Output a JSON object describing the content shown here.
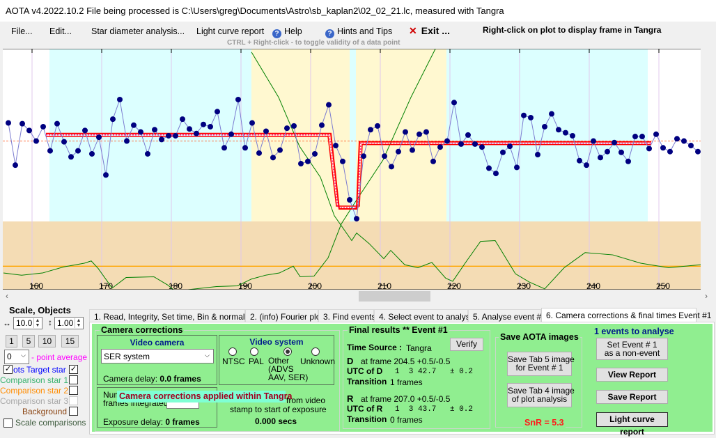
{
  "window": {
    "title": "AOTA v4.2022.10.2    File being processed is C:\\Users\\greg\\Documents\\Astro\\sb_kaplan2\\02_02_21.lc, measured with Tangra"
  },
  "menu": {
    "file": "File...",
    "edit": "Edit...",
    "star_diameter": "Star diameter analysis...",
    "light_curve_report": "Light curve report",
    "help": "Help",
    "hints": "Hints and Tips",
    "exit": "Exit ...",
    "exit_icon": "x-icon",
    "help_icon": "question-circle-icon"
  },
  "hint_text": "CTRL + Right-click  -  to toggle validity of a data point",
  "right_click_text": "Right-click on plot to display frame in Tangra",
  "chart_data": {
    "type": "scatter",
    "xticks": [
      160,
      170,
      180,
      190,
      200,
      210,
      220,
      230,
      240,
      250
    ],
    "x_range": [
      155.4,
      255.4
    ],
    "colors": {
      "points": "#000080",
      "line": "#7b7bd0",
      "model": "#ff0000",
      "curve": "#008000",
      "orange": "#ffa500",
      "cyan_region": "#dcffff",
      "yellow_region": "#fff8d0",
      "lower_panel": "#f4dcb4",
      "grid": "#e0c8ec"
    },
    "regions": [
      {
        "kind": "baseline",
        "from": 161.9,
        "to": 190.9
      },
      {
        "kind": "event",
        "from": 190.9,
        "to": 205.0
      },
      {
        "kind": "baseline",
        "from": 205.0,
        "to": 205.9
      },
      {
        "kind": "event",
        "from": 205.9,
        "to": 218.9
      },
      {
        "kind": "baseline",
        "from": 218.9,
        "to": 247.8
      }
    ],
    "points": {
      "x": [
        156,
        157,
        158,
        159,
        160,
        161,
        162,
        163,
        164,
        165,
        166,
        167,
        168,
        169,
        170,
        171,
        172,
        173,
        174,
        175,
        176,
        177,
        178,
        179,
        180,
        181,
        182,
        183,
        184,
        185,
        186,
        187,
        188,
        189,
        190,
        191,
        192,
        193,
        194,
        195,
        196,
        197,
        198,
        199,
        200,
        201,
        202,
        203,
        204,
        205,
        206,
        207,
        208,
        209,
        210,
        211,
        212,
        213,
        214,
        215,
        216,
        217,
        218,
        219,
        220,
        221,
        222,
        223,
        224,
        225,
        226,
        227,
        228,
        229,
        230,
        231,
        232,
        233,
        234,
        235,
        236,
        237,
        238,
        239,
        240,
        241,
        242,
        243,
        244,
        245,
        246,
        247,
        248,
        249,
        250,
        251,
        252,
        253,
        254,
        255
      ],
      "y": [
        1.14,
        0.58,
        1.13,
        1.04,
        0.9,
        1.09,
        0.77,
        1.13,
        0.89,
        0.69,
        0.77,
        1.04,
        0.73,
        0.95,
        0.45,
        1.19,
        1.45,
        0.9,
        1.11,
        1.02,
        0.73,
        1.05,
        0.92,
        0.97,
        0.97,
        1.19,
        1.06,
        1.0,
        1.12,
        1.09,
        1.29,
        0.81,
        0.99,
        1.45,
        0.81,
        1.14,
        0.74,
        1.03,
        0.68,
        0.78,
        1.07,
        1.1,
        0.6,
        0.63,
        0.73,
        1.11,
        1.38,
        0.84,
        0.63,
        0.12,
        -0.13,
        0.7,
        1.05,
        1.1,
        0.7,
        0.56,
        0.76,
        1.02,
        0.78,
        0.99,
        1.02,
        0.63,
        0.82,
        0.9,
        1.41,
        0.86,
        0.98,
        0.86,
        0.82,
        0.54,
        0.47,
        0.75,
        0.83,
        0.55,
        1.24,
        1.21,
        0.72,
        1.09,
        1.26,
        1.05,
        1.01,
        0.97,
        0.64,
        0.58,
        0.9,
        0.68,
        0.76,
        0.88,
        0.75,
        0.63,
        0.96,
        0.96,
        0.8,
        0.99,
        0.81,
        0.76,
        0.93,
        0.9,
        0.84,
        0.76
      ]
    },
    "model": {
      "baseline_before": 1.0,
      "baseline_after": 0.89,
      "event_level": 0.0,
      "start": 161.4,
      "end": 248.3,
      "d_frame": 204.5,
      "r_frame": 207.0
    },
    "mean_level": 0.9,
    "lower_threshold": -0.76,
    "curves": [
      {
        "x": [
          155.3,
          157.9,
          160.9,
          163.9,
          166.9,
          167.9,
          168.9,
          170.9,
          172.9,
          176.9,
          178.9,
          179.9,
          185.9,
          188.9,
          190.9,
          192.9,
          194.9,
          196.9,
          197.9,
          199.9,
          201.9,
          203.8,
          205.8,
          209.8,
          213.8,
          217.3
        ],
        "y": [
          -0.85,
          -0.88,
          -0.85,
          -0.77,
          -0.72,
          -0.69,
          -0.79,
          -1.05,
          -0.91,
          -0.9,
          -1.01,
          -1.09,
          -1.03,
          -1.02,
          -0.93,
          -0.88,
          -0.85,
          -0.76,
          -0.9,
          -0.89,
          -0.65,
          -0.2,
          0.09,
          0.65,
          1.48,
          2.12
        ]
      },
      {
        "x": [
          190.9,
          194.8,
          197.8,
          200.8,
          202.8,
          205.3,
          206.0,
          207.8,
          209.9,
          210.9,
          212.9,
          214.8,
          216.8,
          218.8,
          219.8,
          221.8,
          223.8,
          225.9,
          228.8,
          230.8,
          233.0,
          235.8,
          238.8,
          242.8,
          246.8,
          250.8,
          255.4
        ],
        "y": [
          2.08,
          1.48,
          0.83,
          0.42,
          -0.09,
          -0.42,
          -0.32,
          -0.46,
          -0.66,
          -0.55,
          -0.74,
          -0.78,
          -0.71,
          -0.92,
          -0.96,
          -0.69,
          -0.43,
          -0.42,
          -0.86,
          -0.97,
          -1.06,
          -0.78,
          -0.58,
          -0.61,
          -0.72,
          -0.78,
          -0.74
        ]
      }
    ]
  },
  "left_panel": {
    "title": "Scale,  Objects",
    "h_scale": "10.0",
    "v_scale": "1.00",
    "h_icon": "horizontal-arrows-icon",
    "v_icon": "vertical-arrows-icon",
    "buttons": [
      "1",
      "5",
      "10",
      "15"
    ],
    "average_value": "0",
    "average_label": "- point average",
    "dots_label": "ots",
    "target_label": "Target star",
    "comp1": "Comparison star 1",
    "comp2": "Comparison star 2",
    "comp3": "Comparison star 3",
    "background": "Background",
    "scale_comparisons": "Scale comparisons",
    "colors": {
      "target": "#0000ff",
      "comp1": "#3cb371",
      "comp2": "#ff8c00",
      "comp3": "#a9a9a9",
      "background": "#8b4513",
      "average": "#ff00ff"
    }
  },
  "tabs": [
    {
      "label": "1.  Read, Integrity, Set time, Bin & normalise"
    },
    {
      "label": "2. (info)  Fourier plot"
    },
    {
      "label": "3. Find events"
    },
    {
      "label": "4. Select event to analyse"
    },
    {
      "label": "5. Analyse event #1"
    },
    {
      "label": "6. Camera corrections & final times Event #1",
      "active": true
    }
  ],
  "camera": {
    "group_title": "Camera corrections",
    "video_camera_title": "Video camera",
    "camera_select": "SER system",
    "camera_delay_label": "Camera delay:",
    "camera_delay_value": "0.0 frames",
    "video_system_title": "Video system",
    "systems": [
      "NTSC",
      "PAL",
      "Other\n(ADVS\nAAV, SER)",
      "Unknown"
    ],
    "selected_system": "Other",
    "frames_label_1": "Num",
    "frames_label_2": "frames integrated",
    "exposure_delay_label": "Exposure delay:",
    "exposure_delay_value": "0 frames",
    "offset_label_1": "from video",
    "offset_label_2": "stamp to start of exposure",
    "offset_value": "0.000 secs",
    "tooltip": "Camera corrections applied within Tangra"
  },
  "final": {
    "title": "Final results  **  Event #1",
    "time_source_label": "Time Source :",
    "time_source": "Tangra",
    "verify": "Verify",
    "d_label": "D",
    "d_frame": "at frame 204.5  +0.5/-0.5",
    "utc_d_label": "UTC of D",
    "utc_d": "1  3 42.7",
    "utc_d_err": "± 0.2",
    "transition_label": "Transition",
    "d_transition": "1 frames",
    "r_label": "R",
    "r_frame": "at frame 207.0  +0.5/-0.5",
    "utc_r_label": "UTC of R",
    "utc_r": "1  3 43.7",
    "utc_r_err": "± 0.2",
    "r_transition": "0 frames"
  },
  "save": {
    "title": "Save AOTA images",
    "tab5": "Save Tab 5 image\nfor Event # 1",
    "tab4": "Save Tab 4 image\nof plot analysis",
    "snr": "SnR = 5.3"
  },
  "actions": {
    "events_count": "1  events to analyse",
    "non_event": "Set Event # 1\nas a non-event",
    "view_report": "View Report",
    "save_report": "Save Report",
    "light_curve_report": "Light curve report"
  }
}
